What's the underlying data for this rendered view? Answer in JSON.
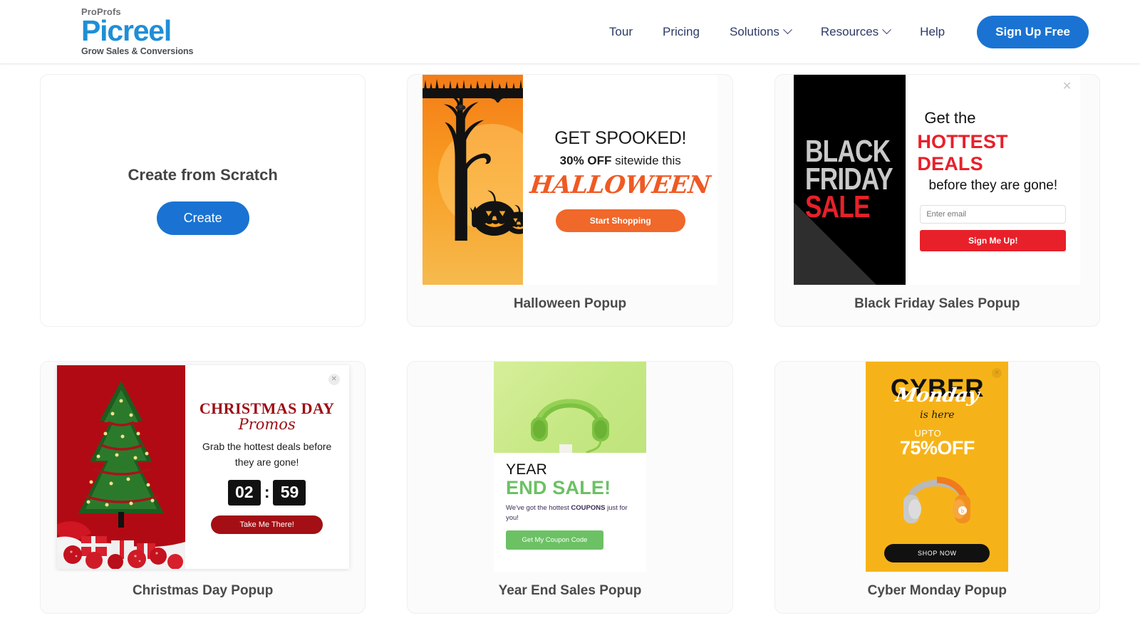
{
  "header": {
    "logo": {
      "top": "ProProfs",
      "main": "Picreel",
      "tagline": "Grow Sales & Conversions"
    },
    "nav": [
      {
        "label": "Tour",
        "caret": false
      },
      {
        "label": "Pricing",
        "caret": false
      },
      {
        "label": "Solutions",
        "caret": true
      },
      {
        "label": "Resources",
        "caret": true
      },
      {
        "label": "Help",
        "caret": false
      }
    ],
    "signup_label": "Sign Up Free",
    "accent_color": "#1a73d2"
  },
  "cards": {
    "scratch": {
      "title": "Create from Scratch",
      "button": "Create"
    },
    "halloween": {
      "card_title": "Halloween Popup",
      "heading": "GET SPOOKED!",
      "sub_bold": "30% OFF",
      "sub_rest": " sitewide this",
      "script": "HALLOWEEN",
      "button": "Start Shopping",
      "accent": "#f0682a"
    },
    "blackfriday": {
      "card_title": "Black Friday Sales Popup",
      "art_line1": "BLACK",
      "art_line2": "FRIDAY",
      "art_line3": "SALE",
      "t1": "Get the",
      "t2": "HOTTEST DEALS",
      "t3": "before they are gone!",
      "email_placeholder": "Enter email",
      "button": "Sign Me Up!",
      "close_icon": "close-icon",
      "accent": "#e8202a"
    },
    "christmas": {
      "card_title": "Christmas Day Popup",
      "t1": "CHRISTMAS DAY",
      "t2": "Promos",
      "t3": "Grab the hottest deals before they are gone!",
      "timer_minutes": "02",
      "timer_separator": ":",
      "timer_seconds": "59",
      "button": "Take Me There!",
      "close_icon": "close-icon",
      "accent": "#a30f14"
    },
    "yearend": {
      "card_title": "Year End Sales Popup",
      "t1": "YEAR",
      "t2": "END SALE!",
      "t3_a": "We've got the hottest ",
      "t3_b": "COUPONS",
      "t3_c": " just for you!",
      "button": "Get My Coupon Code",
      "accent": "#6cc164"
    },
    "cybermonday": {
      "card_title": "Cyber Monday Popup",
      "t1": "CYBER",
      "t2": "Monday",
      "t3": "is here",
      "upto": "UPTO",
      "discount": "75%OFF",
      "button": "SHOP NOW",
      "close_icon": "close-icon",
      "accent": "#f6b319"
    }
  }
}
